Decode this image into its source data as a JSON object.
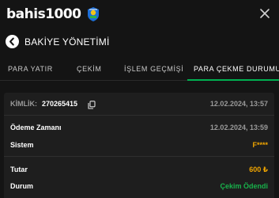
{
  "brand": {
    "logo_text": "bahis1000"
  },
  "header": {
    "title": "BAKİYE YÖNETİMİ"
  },
  "tabs": [
    {
      "label": "PARA YATIR"
    },
    {
      "label": "ÇEKİM"
    },
    {
      "label": "İŞLEM GEÇMİŞİ"
    },
    {
      "label": "PARA ÇEKME DURUMU",
      "active": true
    }
  ],
  "record": {
    "id_label": "KİMLİK:",
    "id_value": "270265415",
    "created_at": "12.02.2024, 13:57",
    "rows": [
      {
        "label": "Ödeme Zamanı",
        "value": "12.02.2024, 13:59"
      },
      {
        "label": "Sistem",
        "value": "F****"
      },
      {
        "label": "Tutar",
        "value": "600 ₺"
      },
      {
        "label": "Durum",
        "value": "Çekim Ödendi"
      }
    ]
  },
  "colors": {
    "accent": "#00b050",
    "amount": "#f0a500",
    "status_paid": "#18b24b",
    "background": "#141414",
    "card": "#1e1e1e"
  },
  "icons": {
    "close": "close-icon",
    "back": "back-arrow-icon",
    "copy": "copy-icon",
    "badge": "mascot-badge-icon"
  }
}
